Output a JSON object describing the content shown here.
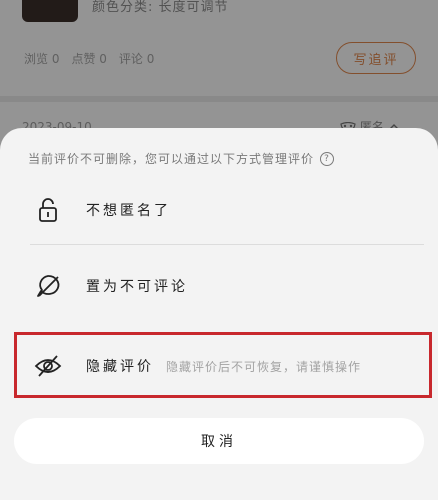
{
  "background": {
    "color_spec": "颜色分类: 长度可调节",
    "stats": {
      "views": "浏览 0",
      "likes": "点赞 0",
      "comments": "评论 0"
    },
    "write_review_label": "写追评",
    "card2_date": "2023-09-10",
    "card2_anon_label": "匿名"
  },
  "sheet": {
    "tip": "当前评价不可删除，您可以通过以下方式管理评价",
    "options": [
      {
        "label": "不想匿名了",
        "icon": "lock-open-icon"
      },
      {
        "label": "置为不可评论",
        "icon": "comment-disabled-icon"
      },
      {
        "label": "隐藏评价",
        "sublabel": "隐藏评价后不可恢复，请谨慎操作",
        "icon": "eye-hidden-icon"
      }
    ],
    "cancel_label": "取消"
  },
  "colors": {
    "accent": "#e2894f",
    "highlight_border": "#c8282d",
    "sheet_bg": "#f3f3f3"
  }
}
